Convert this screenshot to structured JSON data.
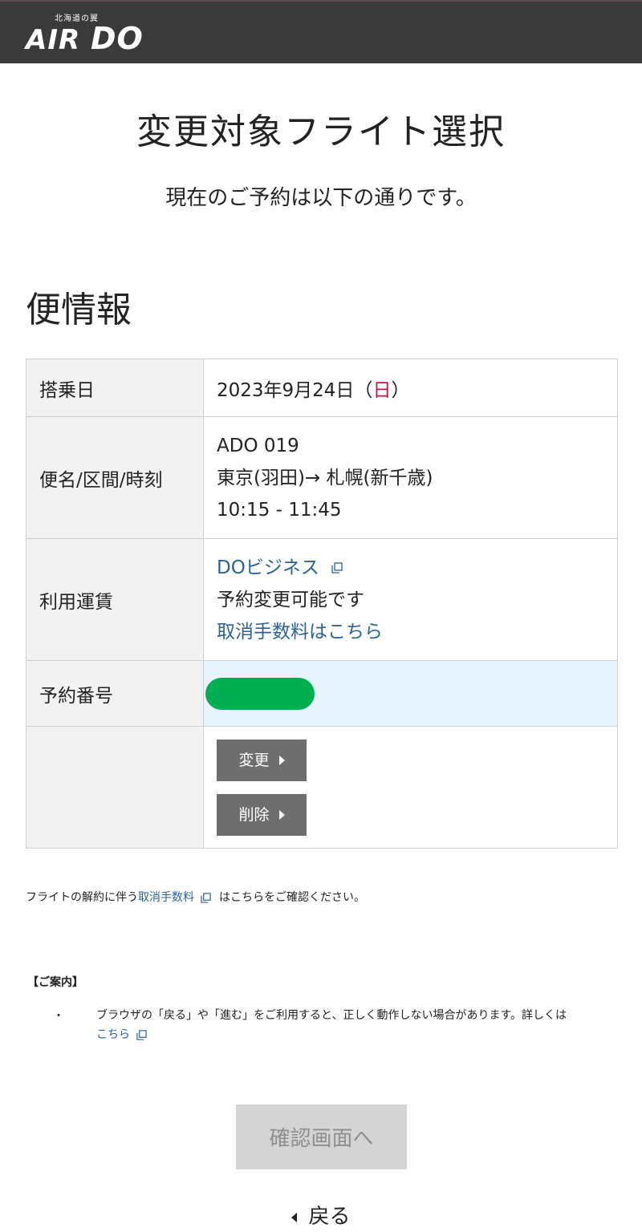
{
  "header": {
    "logo_sub": "北海道の翼",
    "logo_air": "AIR",
    "logo_do": "DO"
  },
  "page": {
    "title": "変更対象フライト選択",
    "lead": "現在のご予約は以下の通りです。",
    "section_title": "便情報"
  },
  "table": {
    "date_label": "搭乗日",
    "date_value_prefix": "2023年9月24日（",
    "date_weekday": "日",
    "date_value_suffix": "）",
    "flight_label": "便名/区間/時刻",
    "flight_number": "ADO 019",
    "flight_route": "東京(羽田)→ 札幌(新千歳)",
    "flight_time": "10:15 - 11:45",
    "fare_label": "利用運賃",
    "fare_name": "DOビジネス",
    "fare_status": "予約変更可能です",
    "fare_cancel_link": "取消手数料はこちら",
    "reservation_label": "予約番号",
    "change_button": "変更",
    "delete_button": "削除"
  },
  "note": {
    "before": "フライトの解約に伴う",
    "link": "取消手数料",
    "after": "はこちらをご確認ください。"
  },
  "guide": {
    "title": "【ご案内】",
    "bullet": "・",
    "text": "ブラウザの「戻る」や「進む」をご利用すると、正しく動作しない場合があります。詳しくは",
    "link": "こちら"
  },
  "actions": {
    "confirm_button": "確認画面へ",
    "back_link": "戻る"
  },
  "colors": {
    "header_bg": "#3a3a3a",
    "link": "#2a6496",
    "sunday_red": "#d0103a",
    "masked_green": "#00b050",
    "reservation_bg": "#e8f4fd",
    "action_button_bg": "#6e6e6e",
    "confirm_disabled_bg": "#d4d4d4"
  },
  "icons": {
    "external_link": "external-link-icon",
    "arrow_right": "caret-right-icon",
    "arrow_left": "caret-left-icon"
  }
}
